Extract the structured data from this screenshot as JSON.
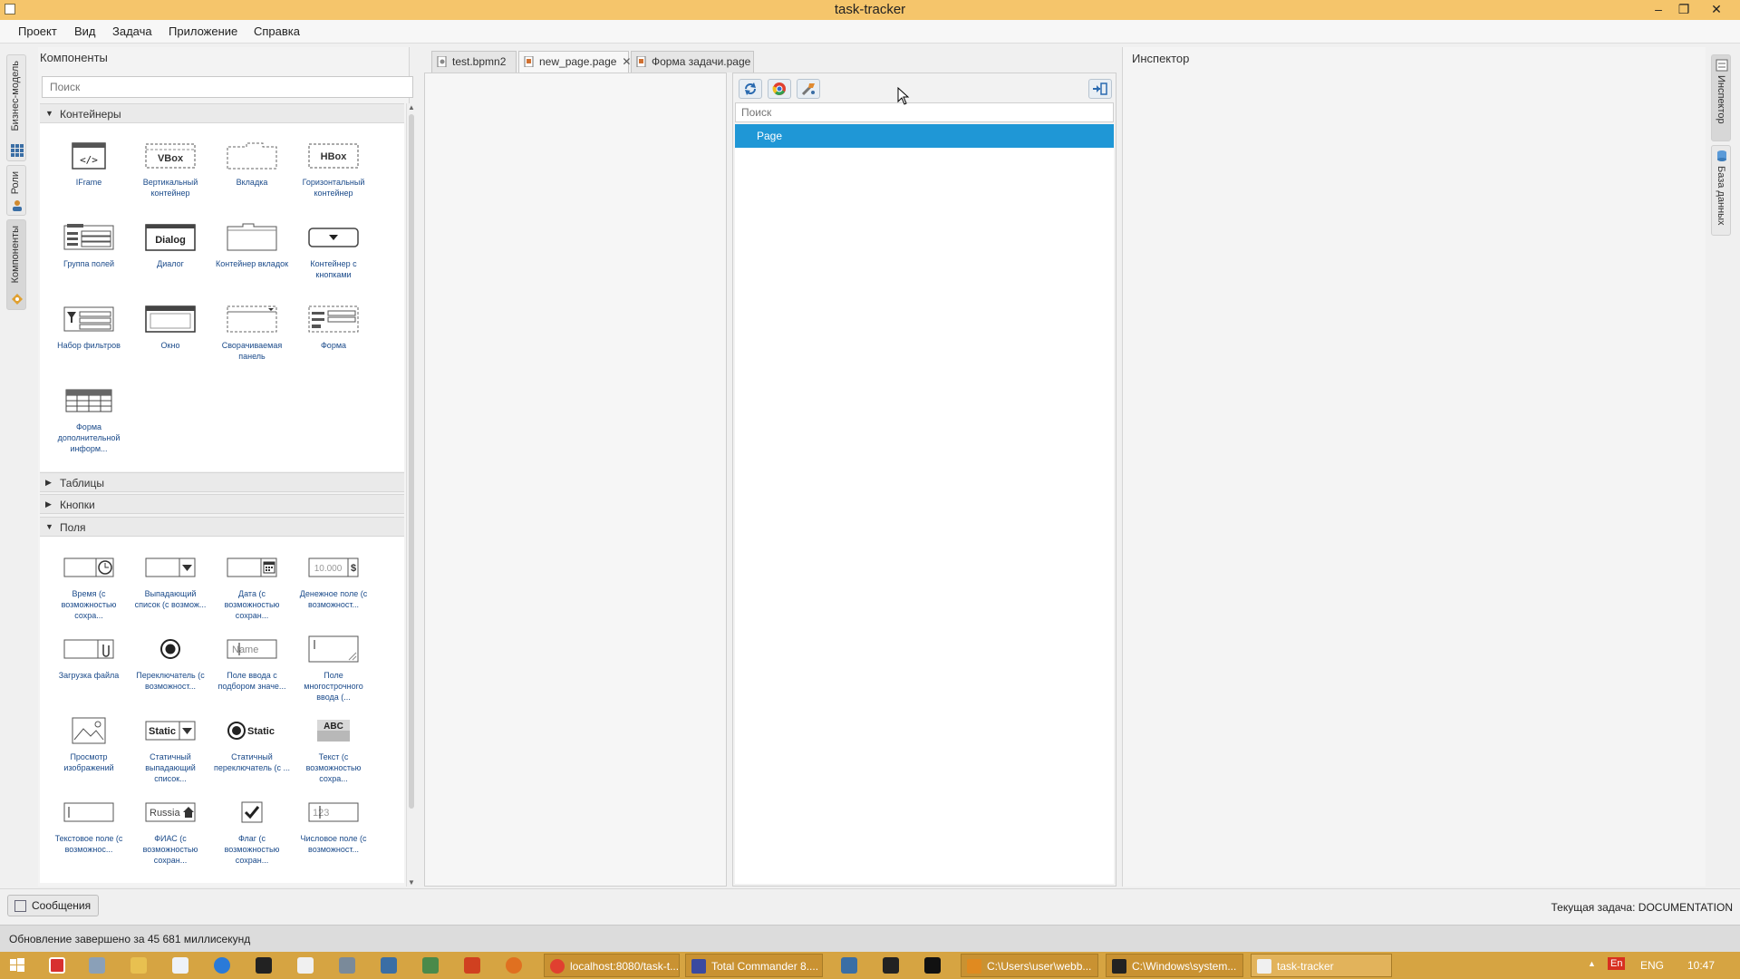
{
  "window": {
    "title": "task-tracker"
  },
  "menu": [
    "Проект",
    "Вид",
    "Задача",
    "Приложение",
    "Справка"
  ],
  "left_strip": [
    {
      "label": "Бизнес-модель",
      "icon": "grid-icon"
    },
    {
      "label": "Роли",
      "icon": "roles-icon"
    },
    {
      "label": "Компоненты",
      "icon": "components-icon"
    }
  ],
  "right_strip": [
    {
      "label": "Инспектор",
      "icon": "inspector-icon"
    },
    {
      "label": "База данных",
      "icon": "database-icon"
    }
  ],
  "components": {
    "title": "Компоненты",
    "search_placeholder": "Поиск",
    "sections": {
      "containers": {
        "label": "Контейнеры",
        "items": [
          {
            "label": "IFrame",
            "icon": "iframe-icon"
          },
          {
            "label": "Вертикальный контейнер",
            "icon": "vbox-icon",
            "icon_text": "VBox"
          },
          {
            "label": "Вкладка",
            "icon": "tab-icon"
          },
          {
            "label": "Горизонтальный контейнер",
            "icon": "hbox-icon",
            "icon_text": "HBox"
          },
          {
            "label": "Группа полей",
            "icon": "field-group-icon"
          },
          {
            "label": "Диалог",
            "icon": "dialog-icon",
            "icon_text": "Dialog"
          },
          {
            "label": "Контейнер вкладок",
            "icon": "tab-container-icon"
          },
          {
            "label": "Контейнер с кнопками",
            "icon": "button-container-icon"
          },
          {
            "label": "Набор фильтров",
            "icon": "filter-set-icon"
          },
          {
            "label": "Окно",
            "icon": "window-icon"
          },
          {
            "label": "Сворачиваемая панель",
            "icon": "collapsible-panel-icon"
          },
          {
            "label": "Форма",
            "icon": "form-icon"
          },
          {
            "label": "Форма дополнительной информ...",
            "icon": "extra-info-form-icon"
          }
        ]
      },
      "tables": {
        "label": "Таблицы"
      },
      "buttons": {
        "label": "Кнопки"
      },
      "fields": {
        "label": "Поля",
        "items": [
          {
            "label": "Время (с возможностью сохра...",
            "icon": "time-field-icon"
          },
          {
            "label": "Выпадающий список (с возмож...",
            "icon": "dropdown-icon"
          },
          {
            "label": "Дата (с возможностью сохран...",
            "icon": "date-field-icon"
          },
          {
            "label": "Денежное поле (с возможност...",
            "icon": "money-field-icon",
            "icon_text": "10.000",
            "icon_text2": "$"
          },
          {
            "label": "Загрузка файла",
            "icon": "file-upload-icon"
          },
          {
            "label": "Переключатель (с возможност...",
            "icon": "radio-icon"
          },
          {
            "label": "Поле ввода с подбором значе...",
            "icon": "autocomplete-icon",
            "icon_text": "Name"
          },
          {
            "label": "Поле многострочного ввода (...",
            "icon": "textarea-icon"
          },
          {
            "label": "Просмотр изображений",
            "icon": "image-viewer-icon"
          },
          {
            "label": "Статичный выпадающий список...",
            "icon": "static-dropdown-icon",
            "icon_text": "Static"
          },
          {
            "label": "Статичный переключатель (с ...",
            "icon": "static-radio-icon",
            "icon_text": "Static"
          },
          {
            "label": "Текст (с возможностью сохра...",
            "icon": "text-icon",
            "icon_text": "ABC"
          },
          {
            "label": "Текстовое поле (с возможнос...",
            "icon": "text-field-icon"
          },
          {
            "label": "ФИАС (с возможностью сохран...",
            "icon": "fias-icon",
            "icon_text": "Russia"
          },
          {
            "label": "Флаг (с возможностью сохран...",
            "icon": "checkbox-icon"
          },
          {
            "label": "Числовое поле (с возможност...",
            "icon": "number-field-icon",
            "icon_text": "123"
          }
        ]
      }
    }
  },
  "editor": {
    "tabs": [
      {
        "label": "test.bpmn2",
        "icon": "bpmn-file-icon",
        "active": false
      },
      {
        "label": "new_page.page",
        "icon": "page-file-icon",
        "active": true,
        "closable": true
      },
      {
        "label": "Форма задачи.page",
        "icon": "page-file-icon",
        "active": false
      }
    ],
    "tree_search_placeholder": "Поиск",
    "tree_items": [
      "Page"
    ],
    "toolbar": [
      "refresh-icon",
      "chrome-icon",
      "build-icon",
      "exit-icon"
    ]
  },
  "inspector": {
    "title": "Инспектор"
  },
  "bottom": {
    "messages_button": "Сообщения",
    "current_task": "Текущая задача: DOCUMENTATION"
  },
  "status": {
    "text": "Обновление завершено за 45 681 миллисекунд"
  },
  "taskbar": {
    "tasks": [
      {
        "label": "localhost:8080/task-t...",
        "icon": "chrome-icon"
      },
      {
        "label": "Total Commander 8....",
        "icon": "total-commander-icon"
      },
      {
        "label": "C:\\Users\\user\\webb...",
        "icon": "sublime-icon"
      },
      {
        "label": "C:\\Windows\\system...",
        "icon": "cmd-icon"
      },
      {
        "label": "task-tracker",
        "icon": "task-tracker-icon"
      }
    ],
    "lang_badge": "En",
    "lang": "ENG",
    "clock": "10:47"
  },
  "colors": {
    "accent": "#1f97d6",
    "titlebar": "#f5c56b",
    "taskbar": "#d6a442"
  }
}
